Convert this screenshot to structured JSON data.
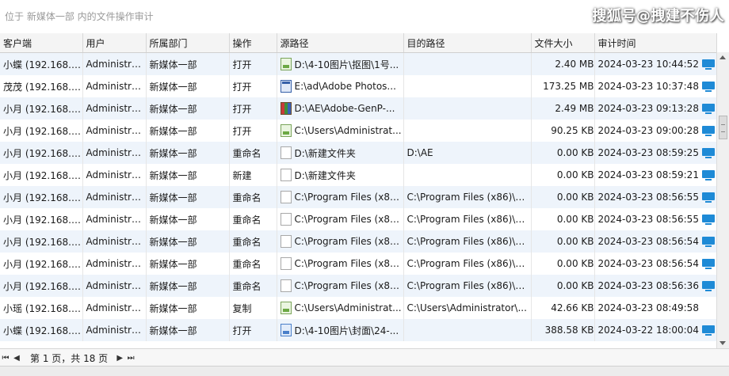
{
  "search": {
    "placeholder": "位于 新媒体一部 内的文件操作审计"
  },
  "watermark": "搜狐号@拽建不伤人",
  "columns": [
    "客户端",
    "用户",
    "所属部门",
    "操作",
    "源路径",
    "目的路径",
    "文件大小",
    "审计时间"
  ],
  "rows": [
    {
      "client": "小蝶 (192.168.3...",
      "user": "Administra...",
      "dept": "新媒体一部",
      "op": "打开",
      "icon": "image-file-icon",
      "src": "D:\\4-10图片\\抠图\\1号...",
      "dst": "",
      "size": "2.40 MB",
      "time": "2024-03-23 10:44:52",
      "monitor": true
    },
    {
      "client": "茂茂 (192.168.3...",
      "user": "Administra...",
      "dept": "新媒体一部",
      "op": "打开",
      "icon": "exe-file-icon",
      "src": "E:\\ad\\Adobe Photos...",
      "dst": "",
      "size": "173.25 MB",
      "time": "2024-03-23 10:37:48",
      "monitor": true
    },
    {
      "client": "小月 (192.168.3...",
      "user": "Administra...",
      "dept": "新媒体一部",
      "op": "打开",
      "icon": "archive-file-icon",
      "src": "D:\\AE\\Adobe-GenP-...",
      "dst": "",
      "size": "2.49 MB",
      "time": "2024-03-23 09:13:28",
      "monitor": true
    },
    {
      "client": "小月 (192.168.3...",
      "user": "Administra...",
      "dept": "新媒体一部",
      "op": "打开",
      "icon": "image-file-icon",
      "src": "C:\\Users\\Administrat...",
      "dst": "",
      "size": "90.25 KB",
      "time": "2024-03-23 09:00:28",
      "monitor": true
    },
    {
      "client": "小月 (192.168.3...",
      "user": "Administra...",
      "dept": "新媒体一部",
      "op": "重命名",
      "icon": "folder-file-icon",
      "src": "D:\\新建文件夹",
      "dst": "D:\\AE",
      "size": "0.00 KB",
      "time": "2024-03-23 08:59:25",
      "monitor": true
    },
    {
      "client": "小月 (192.168.3...",
      "user": "Administra...",
      "dept": "新媒体一部",
      "op": "新建",
      "icon": "folder-file-icon",
      "src": "D:\\新建文件夹",
      "dst": "",
      "size": "0.00 KB",
      "time": "2024-03-23 08:59:21",
      "monitor": true
    },
    {
      "client": "小月 (192.168.3...",
      "user": "Administra...",
      "dept": "新媒体一部",
      "op": "重命名",
      "icon": "doc-file-icon",
      "src": "C:\\Program Files (x86...",
      "dst": "C:\\Program Files (x86)\\C...",
      "size": "0.00 KB",
      "time": "2024-03-23 08:56:55",
      "monitor": true
    },
    {
      "client": "小月 (192.168.3...",
      "user": "Administra...",
      "dept": "新媒体一部",
      "op": "重命名",
      "icon": "doc-file-icon",
      "src": "C:\\Program Files (x86...",
      "dst": "C:\\Program Files (x86)\\C...",
      "size": "0.00 KB",
      "time": "2024-03-23 08:56:55",
      "monitor": true
    },
    {
      "client": "小月 (192.168.3...",
      "user": "Administra...",
      "dept": "新媒体一部",
      "op": "重命名",
      "icon": "doc-file-icon",
      "src": "C:\\Program Files (x86...",
      "dst": "C:\\Program Files (x86)\\C...",
      "size": "0.00 KB",
      "time": "2024-03-23 08:56:54",
      "monitor": true
    },
    {
      "client": "小月 (192.168.3...",
      "user": "Administra...",
      "dept": "新媒体一部",
      "op": "重命名",
      "icon": "doc-file-icon",
      "src": "C:\\Program Files (x86...",
      "dst": "C:\\Program Files (x86)\\C...",
      "size": "0.00 KB",
      "time": "2024-03-23 08:56:54",
      "monitor": true
    },
    {
      "client": "小月 (192.168.3...",
      "user": "Administra...",
      "dept": "新媒体一部",
      "op": "重命名",
      "icon": "doc-file-icon",
      "src": "C:\\Program Files (x86...",
      "dst": "C:\\Program Files (x86)\\C...",
      "size": "0.00 KB",
      "time": "2024-03-23 08:56:36",
      "monitor": true
    },
    {
      "client": "小瑶 (192.168.3...",
      "user": "Administra...",
      "dept": "新媒体一部",
      "op": "复制",
      "icon": "image-file-icon",
      "src": "C:\\Users\\Administrat...",
      "dst": "C:\\Users\\Administrator\\...",
      "size": "42.66 KB",
      "time": "2024-03-23 08:49:58",
      "monitor": false
    },
    {
      "client": "小蝶 (192.168.3...",
      "user": "Administra...",
      "dept": "新媒体一部",
      "op": "打开",
      "icon": "tif-file-icon",
      "src": "D:\\4-10图片\\封面\\24-...",
      "dst": "",
      "size": "388.58 KB",
      "time": "2024-03-22 18:00:04",
      "monitor": true
    }
  ],
  "pager": {
    "text": "第 1 页，共 18 页"
  },
  "colors": {
    "accent": "#1e8ad6",
    "row_alt": "#eef4fb"
  }
}
